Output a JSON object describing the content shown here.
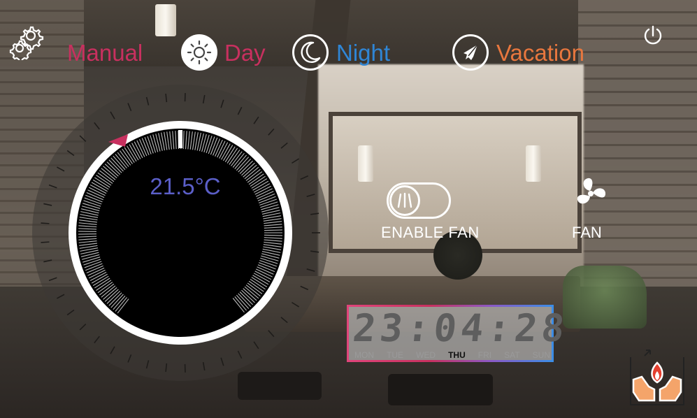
{
  "header": {
    "modes": {
      "manual": "Manual",
      "day": "Day",
      "night": "Night",
      "vacation": "Vacation"
    }
  },
  "thermostat": {
    "setpoint": "21.5°C"
  },
  "fan": {
    "enable_label": "ENABLE FAN",
    "fan_label": "FAN"
  },
  "clock": {
    "time": "23:04:28",
    "days": [
      "MON",
      "TUE",
      "WED",
      "THU",
      "FRI",
      "SAT",
      "SUN"
    ],
    "active_day": "THU"
  },
  "colors": {
    "manual": "#c8305f",
    "day": "#c8305f",
    "night": "#2f86d6",
    "vacation": "#e8773e",
    "setpoint_text": "#5b5fc8"
  },
  "icons": {
    "settings": "gear-icon",
    "power": "power-icon",
    "day": "sun-icon",
    "night": "moon-icon",
    "vacation": "airplane-icon",
    "enable_fan": "fan-toggle-icon",
    "fan": "fan-icon",
    "heating": "flame-hands-icon"
  }
}
